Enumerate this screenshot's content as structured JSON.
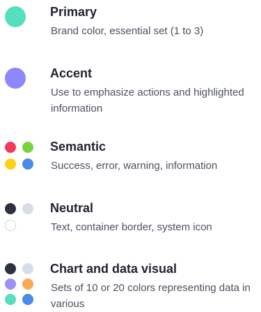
{
  "colors": {
    "primary": "#55dfbd",
    "accent": "#8c87fd",
    "red": "#f03b5f",
    "green": "#78d43b",
    "yellow": "#fdd215",
    "blue": "#4c8ae8",
    "dark": "#2d3240",
    "light": "#d7dee6",
    "purple": "#9b91f9",
    "orange": "#f9a955"
  },
  "items": [
    {
      "title": "Primary",
      "description": "Brand color, essential set (1 to 3)",
      "icons": [
        "circle-swatch-icon"
      ]
    },
    {
      "title": "Accent",
      "description": "Use to emphasize actions and highlighted information",
      "icons": [
        "circle-swatch-icon"
      ]
    },
    {
      "title": "Semantic",
      "description": "Success, error, warning, information",
      "icons": [
        "circle-swatch-icon"
      ]
    },
    {
      "title": "Neutral",
      "description": "Text, container border, system icon",
      "icons": [
        "circle-swatch-icon"
      ]
    },
    {
      "title": "Chart and data visual",
      "description": "Sets of 10 or 20 colors representing data in various",
      "icons": [
        "circle-swatch-icon"
      ]
    }
  ]
}
